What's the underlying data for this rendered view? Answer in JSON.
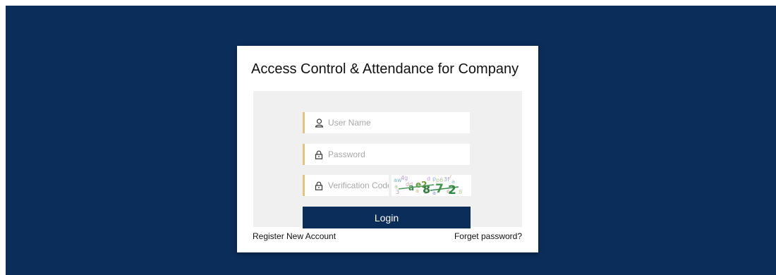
{
  "title": "Access Control & Attendance for Company",
  "form": {
    "username": {
      "placeholder": "User Name",
      "value": "",
      "icon": "user-icon"
    },
    "password": {
      "placeholder": "Password",
      "value": "",
      "icon": "lock-icon"
    },
    "verification": {
      "placeholder": "Verification Code",
      "value": "",
      "icon": "lock-icon"
    },
    "login_label": "Login"
  },
  "links": {
    "register": "Register New Account",
    "forgot": "Forget password?"
  },
  "colors": {
    "background": "#0b2d5a",
    "button": "#0b2d5a",
    "field_accent": "#e6c27a",
    "panel": "#f0f0f0"
  }
}
